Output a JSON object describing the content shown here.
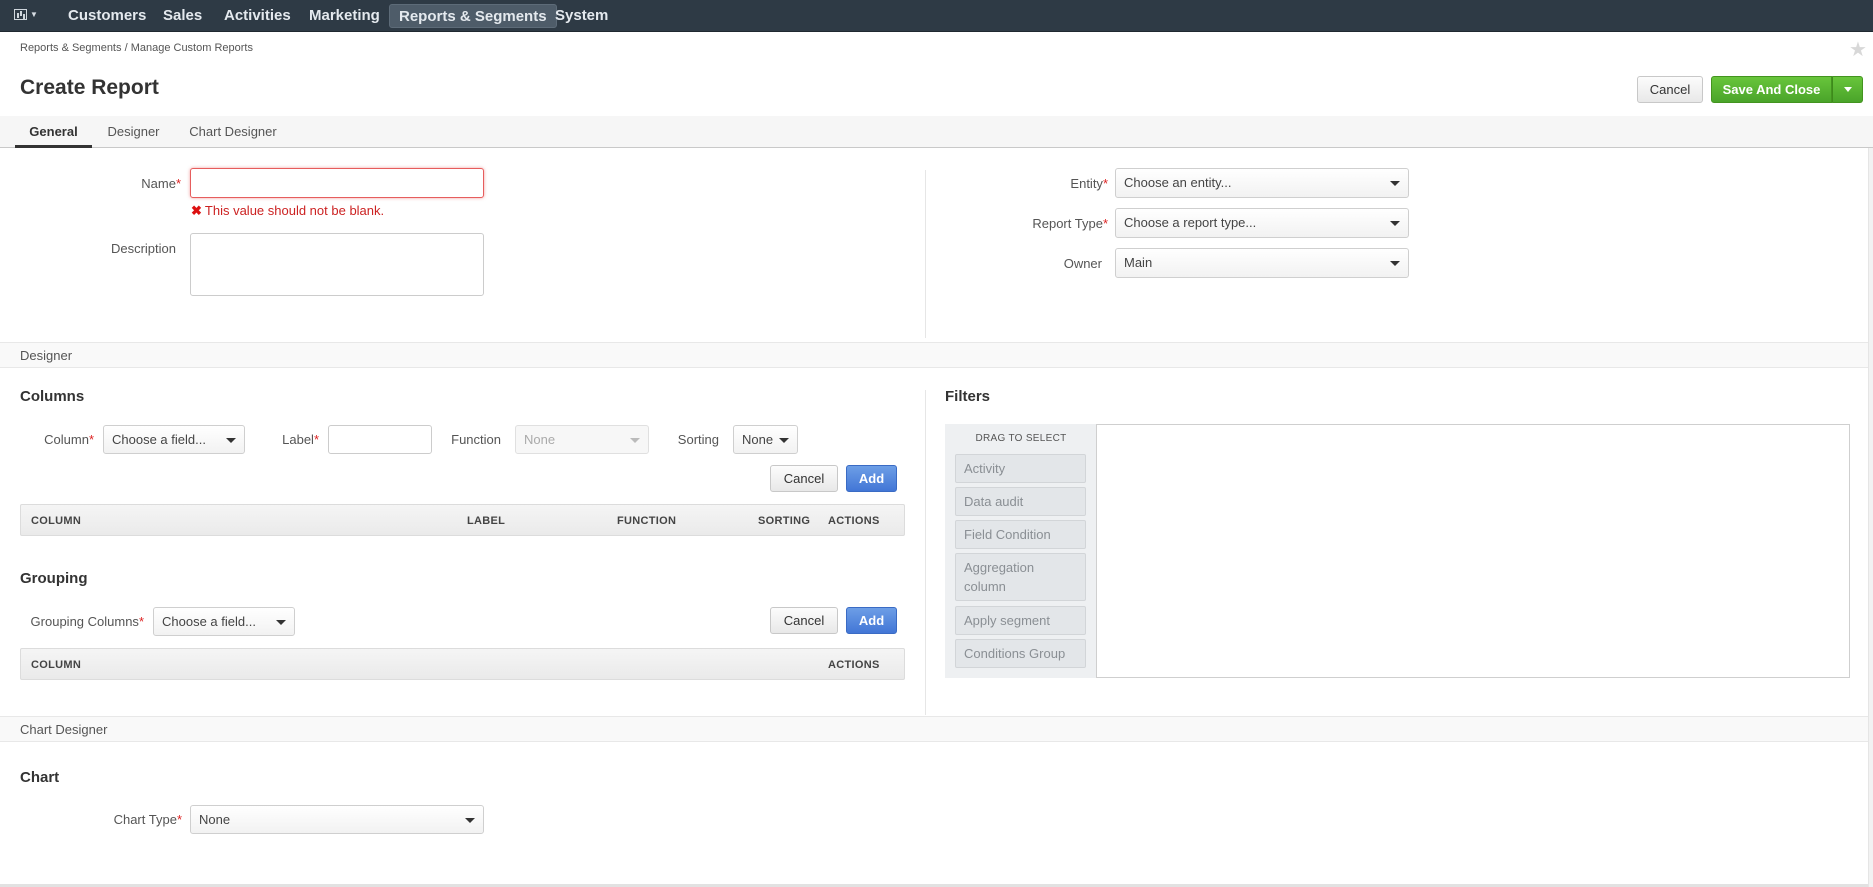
{
  "nav": {
    "dashboard_icon": "bar-chart-icon",
    "items": [
      "Customers",
      "Sales",
      "Activities",
      "Marketing",
      "Reports & Segments",
      "System"
    ],
    "active": "Reports & Segments"
  },
  "breadcrumb": {
    "parent": "Reports & Segments",
    "separator": "/",
    "current": "Manage Custom Reports"
  },
  "page": {
    "title": "Create Report",
    "cancel_label": "Cancel",
    "save_label": "Save And Close"
  },
  "tabs": [
    "General",
    "Designer",
    "Chart Designer"
  ],
  "general": {
    "name_label": "Name",
    "name_value": "",
    "name_error": "This value should not be blank.",
    "description_label": "Description",
    "entity_label": "Entity",
    "entity_value": "Choose an entity...",
    "report_type_label": "Report Type",
    "report_type_value": "Choose a report type...",
    "owner_label": "Owner",
    "owner_value": "Main"
  },
  "designer": {
    "section_title": "Designer",
    "columns": {
      "title": "Columns",
      "column_label": "Column",
      "column_value": "Choose a field...",
      "label_label": "Label",
      "label_value": "",
      "function_label": "Function",
      "function_value": "None",
      "sorting_label": "Sorting",
      "sorting_value": "None",
      "cancel_label": "Cancel",
      "add_label": "Add",
      "headers": [
        "COLUMN",
        "LABEL",
        "FUNCTION",
        "SORTING",
        "ACTIONS"
      ]
    },
    "grouping": {
      "title": "Grouping",
      "columns_label": "Grouping Columns",
      "columns_value": "Choose a field...",
      "cancel_label": "Cancel",
      "add_label": "Add",
      "headers": [
        "COLUMN",
        "ACTIONS"
      ]
    },
    "filters": {
      "title": "Filters",
      "drag_label": "DRAG TO SELECT",
      "criteria": [
        "Activity",
        "Data audit",
        "Field Condition",
        "Aggregation column",
        "Apply segment",
        "Conditions Group"
      ]
    }
  },
  "chart_designer": {
    "section_title": "Chart Designer",
    "title": "Chart",
    "chart_type_label": "Chart Type",
    "chart_type_value": "None"
  },
  "colors": {
    "nav_bg": "#2e3a45",
    "save_green": "#5bb734",
    "add_blue": "#4a7fd9",
    "error_red": "#cc2222"
  }
}
